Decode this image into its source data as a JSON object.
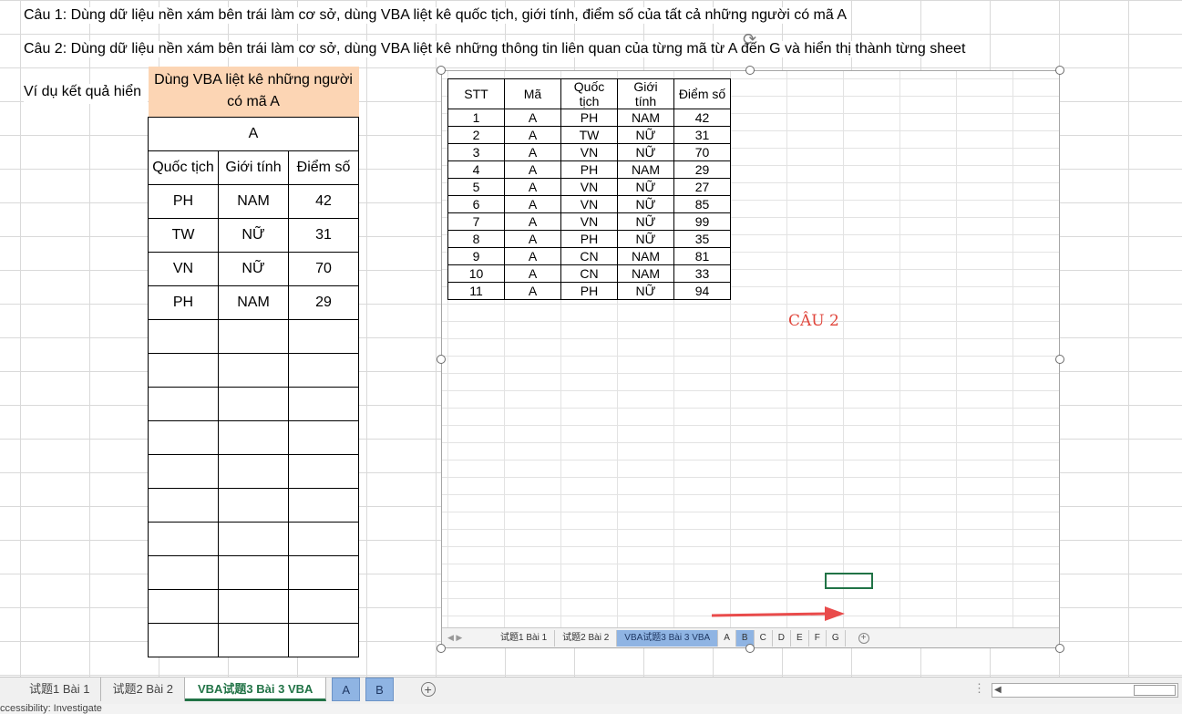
{
  "questions": {
    "q1": "Câu 1:  Dùng dữ liệu nền xám bên trái làm cơ sở, dùng VBA liệt kê quốc tịch, giới tính, điểm số của tất cả những người có mã A",
    "q2": "Câu 2:  Dùng dữ liệu nền xám bên trái làm cơ sở, dùng VBA liệt kê những thông tin liên quan của từng mã từ A đến G và hiển thị thành từng sheet",
    "example_label": "Ví dụ kết quả hiển"
  },
  "result_table": {
    "header": "Dùng VBA liệt kê những người có mã A",
    "code": "A",
    "columns": [
      "Quốc tịch",
      "Giới tính",
      "Điểm số"
    ],
    "rows": [
      [
        "PH",
        "NAM",
        "42"
      ],
      [
        "TW",
        "NỮ",
        "31"
      ],
      [
        "VN",
        "NỮ",
        "70"
      ],
      [
        "PH",
        "NAM",
        "29"
      ]
    ],
    "empty_rows": 10
  },
  "embedded_sheet": {
    "columns": [
      "STT",
      "Mã",
      "Quốc tịch",
      "Giới tính",
      "Điểm số"
    ],
    "rows": [
      [
        "1",
        "A",
        "PH",
        "NAM",
        "42"
      ],
      [
        "2",
        "A",
        "TW",
        "NỮ",
        "31"
      ],
      [
        "3",
        "A",
        "VN",
        "NỮ",
        "70"
      ],
      [
        "4",
        "A",
        "PH",
        "NAM",
        "29"
      ],
      [
        "5",
        "A",
        "VN",
        "NỮ",
        "27"
      ],
      [
        "6",
        "A",
        "VN",
        "NỮ",
        "85"
      ],
      [
        "7",
        "A",
        "VN",
        "NỮ",
        "99"
      ],
      [
        "8",
        "A",
        "PH",
        "NỮ",
        "35"
      ],
      [
        "9",
        "A",
        "CN",
        "NAM",
        "81"
      ],
      [
        "10",
        "A",
        "CN",
        "NAM",
        "33"
      ],
      [
        "11",
        "A",
        "PH",
        "NỮ",
        "94"
      ]
    ],
    "annotation": "CÂU 2",
    "tabs": [
      "试题1 Bài 1",
      "试题2 Bài 2",
      "VBA试题3  Bài 3 VBA",
      "A",
      "B",
      "C",
      "D",
      "E",
      "F",
      "G"
    ],
    "active_tab_index": 2
  },
  "sheet_tabs": {
    "tabs": [
      "试题1 Bài 1",
      "试题2 Bài 2",
      "VBA试题3  Bài 3 VBA"
    ],
    "extra_tabs": [
      "A",
      "B"
    ],
    "active_index": 2
  },
  "status_bar": {
    "text": "ccessibility: Investigate"
  },
  "colors": {
    "header_fill": "#fcd5b4",
    "active_tab": "#217346",
    "highlight_tab": "#8fb4e3",
    "annotation": "#e0463c"
  }
}
